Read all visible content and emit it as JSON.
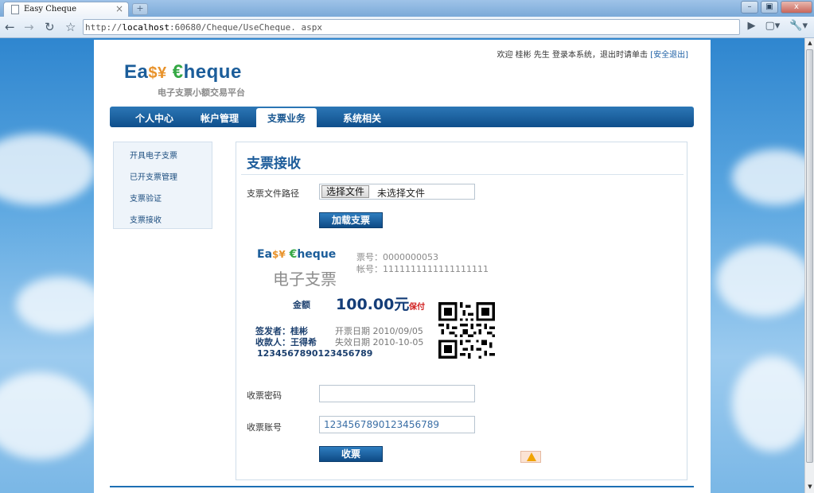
{
  "browser": {
    "tab_title": "Easy Cheque",
    "tab_close": "×",
    "new_tab": "+",
    "url_scheme": "http://",
    "url_host": "localhost",
    "url_path": ":60680/Cheque/UseCheque. aspx",
    "window_buttons": [
      "–",
      "▣",
      "x"
    ]
  },
  "header": {
    "welcome": "欢迎 桂彬 先生 登录本系统，退出时请单击",
    "logout": "[安全退出]",
    "logo_left": "Ea",
    "logo_symbols": "$¥",
    "logo_euro": "€",
    "logo_right": "heque",
    "subtitle": "电子支票小额交易平台"
  },
  "nav": {
    "items": [
      "个人中心",
      "帐户管理",
      "支票业务",
      "系统相关"
    ],
    "active": "支票业务"
  },
  "sidebar": {
    "items": [
      "开具电子支票",
      "已开支票管理",
      "支票验证",
      "支票接收"
    ]
  },
  "form": {
    "title": "支票接收",
    "file_label": "支票文件路径",
    "file_button": "选择文件",
    "file_status": "未选择文件",
    "load_button": "加载支票",
    "password_label": "收票密码",
    "password_value": "",
    "account_label": "收票账号",
    "account_value": "1234567890123456789",
    "receive_button": "收票"
  },
  "cheque": {
    "logo_left": "Ea",
    "logo_symbols": "$¥",
    "logo_euro": "€",
    "logo_right": "heque",
    "name": "电子支票",
    "number": "票号：0000000053",
    "account": "帐号：1111111111111111111",
    "amount_label": "金额",
    "amount": "100.00元",
    "guarantee": "保付",
    "issuer": "签发者：桂彬",
    "payee": "收款人：王得希",
    "issue_date": "开票日期  2010/09/05",
    "expiry_date": "失效日期  2010-10-05",
    "payee_account": "1234567890123456789"
  }
}
